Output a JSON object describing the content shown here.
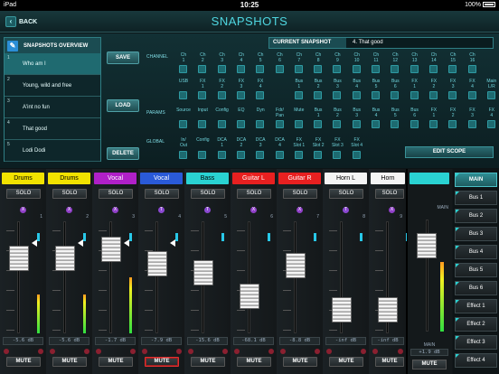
{
  "status": {
    "device": "iPad",
    "time": "10:25",
    "battery": "100%"
  },
  "header": {
    "back_label": "BACK",
    "title": "SNAPSHOTS"
  },
  "overview": {
    "title": "SNAPSHOTS OVERVIEW",
    "items": [
      {
        "num": "1",
        "label": "Who am I",
        "selected": true
      },
      {
        "num": "2",
        "label": "Young, wild and free"
      },
      {
        "num": "3",
        "label": "A'int no fun"
      },
      {
        "num": "4",
        "label": "That good"
      },
      {
        "num": "5",
        "label": "Lodi Dodi"
      }
    ]
  },
  "actions": {
    "save": "SAVE",
    "load": "LOAD",
    "delete": "DELETE",
    "edit_scope": "EDIT SCOPE"
  },
  "current_snapshot": {
    "label": "CURRENT SNAPSHOT",
    "value": "4. That good"
  },
  "scope": {
    "channel_label": "CHANNEL",
    "params_label": "PARAMS",
    "global_label": "GLOBAL",
    "channel_row1": [
      [
        "Ch",
        "1"
      ],
      [
        "Ch",
        "2"
      ],
      [
        "Ch",
        "3"
      ],
      [
        "Ch",
        "4"
      ],
      [
        "Ch",
        "5"
      ],
      [
        "Ch",
        "6"
      ],
      [
        "Ch",
        "7"
      ],
      [
        "Ch",
        "8"
      ],
      [
        "Ch",
        "9"
      ],
      [
        "Ch",
        "10"
      ],
      [
        "Ch",
        "11"
      ],
      [
        "Ch",
        "12"
      ],
      [
        "Ch",
        "13"
      ],
      [
        "Ch",
        "14"
      ],
      [
        "Ch",
        "15"
      ],
      [
        "Ch",
        "16"
      ]
    ],
    "channel_row2": [
      [
        "USB",
        ""
      ],
      [
        "FX",
        "1"
      ],
      [
        "FX",
        "2"
      ],
      [
        "FX",
        "3"
      ],
      [
        "FX",
        "4"
      ],
      [
        "",
        ""
      ],
      [
        "Bus",
        "1"
      ],
      [
        "Bus",
        "2"
      ],
      [
        "Bus",
        "3"
      ],
      [
        "Bus",
        "4"
      ],
      [
        "Bus",
        "5"
      ],
      [
        "Bus",
        "6"
      ],
      [
        "FX",
        "1"
      ],
      [
        "FX",
        "2"
      ],
      [
        "FX",
        "3"
      ],
      [
        "FX",
        "4"
      ],
      [
        "Main",
        "L/R"
      ]
    ],
    "params": [
      [
        "Source",
        ""
      ],
      [
        "Input",
        ""
      ],
      [
        "Config",
        ""
      ],
      [
        "EQ",
        ""
      ],
      [
        "Dyn",
        ""
      ],
      [
        "Fdr/",
        "Pan"
      ],
      [
        "Mute",
        ""
      ],
      [
        "Bus",
        "1"
      ],
      [
        "Bus",
        "2"
      ],
      [
        "Bus",
        "3"
      ],
      [
        "Bus",
        "4"
      ],
      [
        "Bus",
        "5"
      ],
      [
        "Bus",
        "6"
      ],
      [
        "FX",
        "1"
      ],
      [
        "FX",
        "2"
      ],
      [
        "FX",
        "3"
      ],
      [
        "FX",
        "4"
      ]
    ],
    "global": [
      [
        "In/",
        "Out"
      ],
      [
        "Config",
        ""
      ],
      [
        "DCA",
        "1"
      ],
      [
        "DCA",
        "2"
      ],
      [
        "DCA",
        "3"
      ],
      [
        "DCA",
        "4"
      ],
      [
        "FX",
        "Slot 1"
      ],
      [
        "FX",
        "Slot 2"
      ],
      [
        "FX",
        "Slot 3"
      ],
      [
        "FX",
        "Slot 4"
      ]
    ]
  },
  "strips": [
    {
      "name": "Drums",
      "color": "#f2e200",
      "text_color": "#000000",
      "num": "1",
      "db": "-5.6 dB",
      "fader": 0.72,
      "meter": 0.35,
      "mute_active": false
    },
    {
      "name": "Drums",
      "color": "#f2e200",
      "text_color": "#000000",
      "num": "2",
      "db": "-5.6 dB",
      "fader": 0.72,
      "meter": 0.35,
      "mute_active": false
    },
    {
      "name": "Vocal",
      "color": "#b020c8",
      "text_color": "#ffffff",
      "num": "3",
      "db": "-1.7 dB",
      "fader": 0.82,
      "meter": 0.5,
      "mute_active": false
    },
    {
      "name": "Vocal",
      "color": "#2a5ad8",
      "text_color": "#ffffff",
      "num": "4",
      "db": "-7.9 dB",
      "fader": 0.66,
      "meter": 0.0,
      "mute_active": true
    },
    {
      "name": "Bass",
      "color": "#2ad2d2",
      "text_color": "#000000",
      "num": "5",
      "db": "-15.6 dB",
      "fader": 0.55,
      "meter": 0.0,
      "mute_active": false
    },
    {
      "name": "Guitar L",
      "color": "#e82020",
      "text_color": "#ffffff",
      "num": "6",
      "db": "-68.1 dB",
      "fader": 0.28,
      "meter": 0.0,
      "mute_active": false
    },
    {
      "name": "Guitar R",
      "color": "#e82020",
      "text_color": "#ffffff",
      "num": "7",
      "db": "-8.8 dB",
      "fader": 0.64,
      "meter": 0.0,
      "mute_active": false
    },
    {
      "name": "Horn L",
      "color": "#f4f4f4",
      "text_color": "#000000",
      "num": "8",
      "db": "-inf dB",
      "fader": 0.12,
      "meter": 0.0,
      "mute_active": false
    },
    {
      "name": "Horn",
      "color": "#f4f4f4",
      "text_color": "#000000",
      "num": "9",
      "db": "-inf dB",
      "fader": 0.12,
      "meter": 0.0,
      "mute_active": false
    }
  ],
  "labels": {
    "solo": "SOLO",
    "mute": "MUTE",
    "fx_badge": "X",
    "t_badge": "T"
  },
  "main_strip": {
    "label_top": "MAIN",
    "label_bottom": "MAIN",
    "db": "+1.9 dB",
    "fader": 0.84,
    "meter": 0.62,
    "mute": "MUTE",
    "color": "#2ad2d2"
  },
  "buses": [
    {
      "label": "MAIN",
      "selected": true
    },
    {
      "label": "Bus 1"
    },
    {
      "label": "Bus 2"
    },
    {
      "label": "Bus 3"
    },
    {
      "label": "Bus 4"
    },
    {
      "label": "Bus 5"
    },
    {
      "label": "Bus 6"
    },
    {
      "label": "Effect 1"
    },
    {
      "label": "Effect 2"
    },
    {
      "label": "Effect 3"
    },
    {
      "label": "Effect 4"
    }
  ]
}
